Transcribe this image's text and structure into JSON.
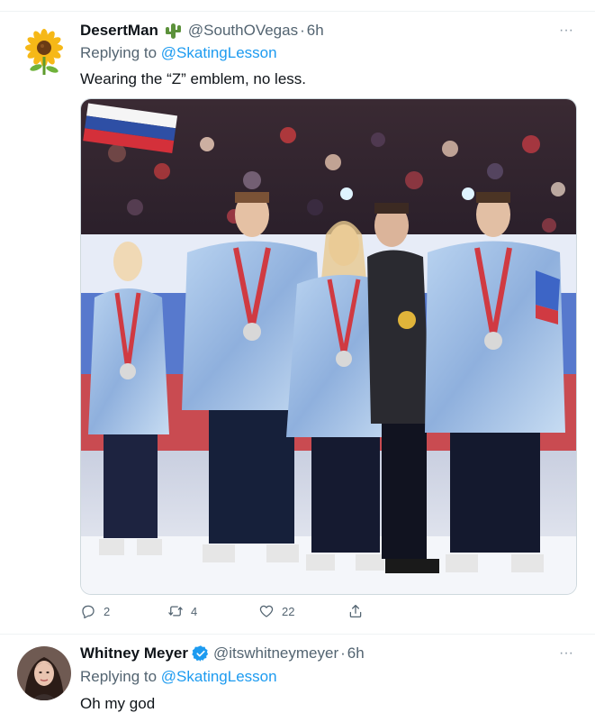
{
  "tweets": [
    {
      "author_name": "DesertMan",
      "name_emoji": "cactus",
      "handle": "@SouthOVegas",
      "separator": "·",
      "time": "6h",
      "replying_prefix": "Replying to",
      "replying_to": "@SkatingLesson",
      "text": "Wearing the “Z” emblem, no less.",
      "avatar": "sunflower",
      "has_media": true,
      "actions": {
        "replies": "2",
        "retweets": "4",
        "likes": "22"
      }
    },
    {
      "author_name": "Whitney Meyer",
      "verified": true,
      "handle": "@itswhitneymeyer",
      "separator": "·",
      "time": "6h",
      "replying_prefix": "Replying to",
      "replying_to": "@SkatingLesson",
      "text": "Oh my god",
      "avatar": "person-photo"
    }
  ],
  "icons": {
    "more": "more-icon",
    "reply": "reply-icon",
    "retweet": "retweet-icon",
    "like": "like-icon",
    "share": "share-icon",
    "verified": "verified-badge-icon"
  },
  "more_glyph": "···",
  "colors": {
    "link": "#1d9bf0",
    "secondary_text": "#536471",
    "primary_text": "#0f1419",
    "divider": "#eff3f4"
  }
}
